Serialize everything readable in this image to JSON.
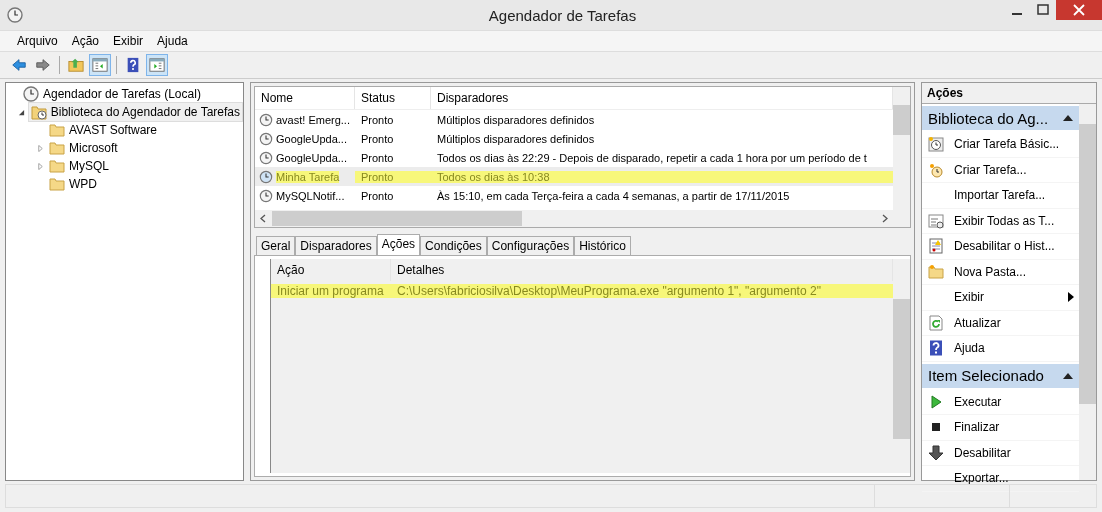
{
  "window": {
    "title": "Agendador de Tarefas"
  },
  "menu": [
    "Arquivo",
    "Ação",
    "Exibir",
    "Ajuda"
  ],
  "toolbar": [
    {
      "kind": "back",
      "pressed": false
    },
    {
      "kind": "forward",
      "pressed": false
    },
    {
      "kind": "sep"
    },
    {
      "kind": "up",
      "pressed": false
    },
    {
      "kind": "tree",
      "pressed": true
    },
    {
      "kind": "sep"
    },
    {
      "kind": "help",
      "pressed": false
    },
    {
      "kind": "actions",
      "pressed": true
    }
  ],
  "tree": [
    {
      "label": "Agendador de Tarefas (Local)",
      "kind": "root",
      "selected": false,
      "children": [
        {
          "label": "Biblioteca do Agendador de Tarefas",
          "kind": "library",
          "selected": true,
          "expanded": true,
          "children": [
            {
              "label": "AVAST Software",
              "kind": "folder",
              "selected": false
            },
            {
              "label": "Microsoft",
              "kind": "folder",
              "selected": false,
              "expanded": false
            },
            {
              "label": "MySQL",
              "kind": "folder",
              "selected": false,
              "expanded": false
            },
            {
              "label": "WPD",
              "kind": "folder",
              "selected": false
            }
          ]
        }
      ]
    }
  ],
  "tasks": {
    "columns": [
      "Nome",
      "Status",
      "Disparadores"
    ],
    "rows": [
      {
        "name": "avast! Emerg...",
        "status": "Pronto",
        "triggers": "Múltiplos disparadores definidos",
        "selected": false,
        "highlighted": false
      },
      {
        "name": "GoogleUpda...",
        "status": "Pronto",
        "triggers": "Múltiplos disparadores definidos",
        "selected": false,
        "highlighted": false
      },
      {
        "name": "GoogleUpda...",
        "status": "Pronto",
        "triggers": "Todos os dias às 22:29 - Depois de disparado, repetir a cada 1 hora por um período de t",
        "selected": false,
        "highlighted": false
      },
      {
        "name": "Minha Tarefa",
        "status": "Pronto",
        "triggers": "Todos os dias às 10:38",
        "selected": true,
        "highlighted": true
      },
      {
        "name": "MySQLNotif...",
        "status": "Pronto",
        "triggers": "Às 15:10, em cada Terça-feira a cada 4 semanas, a partir de 17/11/2015",
        "selected": false,
        "highlighted": false
      }
    ]
  },
  "tabs": [
    {
      "label": "Geral",
      "selected": false
    },
    {
      "label": "Disparadores",
      "selected": false
    },
    {
      "label": "Ações",
      "selected": true
    },
    {
      "label": "Condições",
      "selected": false
    },
    {
      "label": "Configurações",
      "selected": false
    },
    {
      "label": "Histórico",
      "selected": false
    }
  ],
  "actions_table": {
    "columns": [
      "Ação",
      "Detalhes"
    ],
    "rows": [
      {
        "action": "Iniciar um programa",
        "details": "C:\\Users\\fabriciosilva\\Desktop\\MeuPrograma.exe \"argumento 1\", \"argumento 2\"",
        "highlighted": true
      }
    ]
  },
  "actions_pane": {
    "title": "Ações",
    "sections": [
      {
        "title": "Biblioteca do Ag...",
        "expanded": true,
        "items": [
          {
            "label": "Criar Tarefa Básic...",
            "kind": "basic-task",
            "submenu": false
          },
          {
            "label": "Criar Tarefa...",
            "kind": "task",
            "submenu": false
          },
          {
            "label": "Importar Tarefa...",
            "kind": "plain",
            "submenu": false
          },
          {
            "label": "Exibir Todas as T...",
            "kind": "list",
            "submenu": false
          },
          {
            "label": "Desabilitar o Hist...",
            "kind": "log",
            "submenu": false
          },
          {
            "label": "Nova Pasta...",
            "kind": "folder",
            "submenu": false
          },
          {
            "label": "Exibir",
            "kind": "plain",
            "submenu": true
          },
          {
            "label": "Atualizar",
            "kind": "refresh",
            "submenu": false
          },
          {
            "label": "Ajuda",
            "kind": "help",
            "submenu": false
          }
        ]
      },
      {
        "title": "Item Selecionado",
        "expanded": true,
        "items": [
          {
            "label": "Executar",
            "kind": "run",
            "submenu": false
          },
          {
            "label": "Finalizar",
            "kind": "stop",
            "submenu": false
          },
          {
            "label": "Desabilitar",
            "kind": "disable",
            "submenu": false
          },
          {
            "label": "Exportar...",
            "kind": "plain",
            "submenu": false
          }
        ]
      }
    ]
  }
}
